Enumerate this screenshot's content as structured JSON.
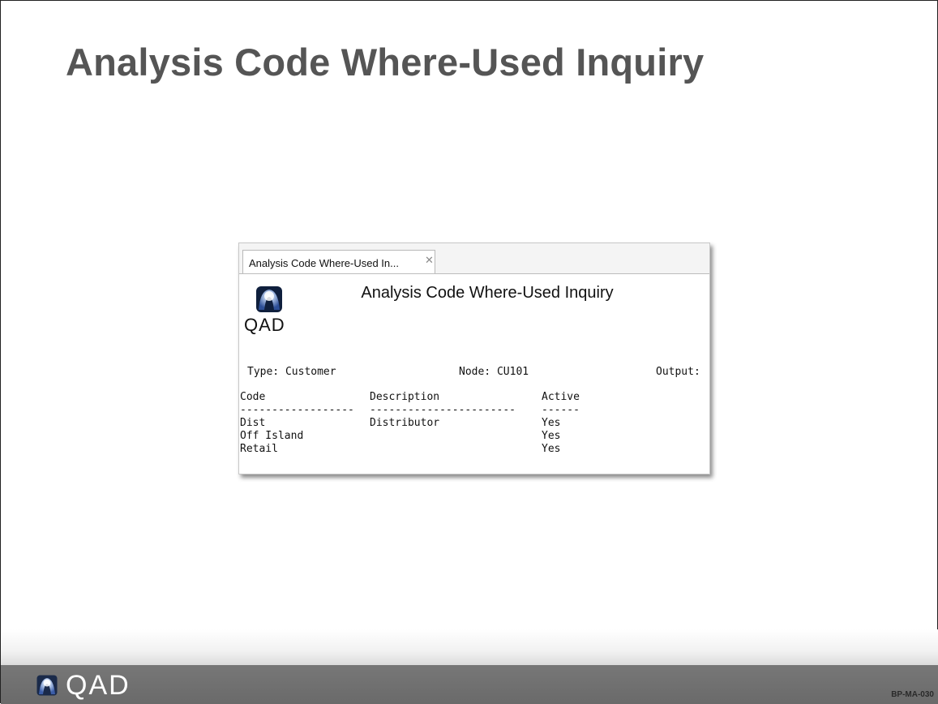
{
  "slide": {
    "title": "Analysis Code Where-Used Inquiry",
    "code": "BP-MA-030",
    "footer_logo_text": "QAD"
  },
  "window": {
    "tab_label": "Analysis Code Where-Used In...",
    "tab_close_glyph": "✕",
    "logo_text": "QAD",
    "report_title": "Analysis Code Where-Used Inquiry",
    "params": {
      "type": "Type: Customer",
      "node": "Node: CU101",
      "output": "Output:"
    },
    "table": {
      "columns": [
        "Code",
        "Description",
        "Active"
      ],
      "separators": [
        "------------------",
        "-----------------------",
        "------"
      ],
      "rows": [
        {
          "code": "Dist",
          "description": "Distributor",
          "active": "Yes"
        },
        {
          "code": "Off Island",
          "description": "",
          "active": "Yes"
        },
        {
          "code": "Retail",
          "description": "",
          "active": "Yes"
        }
      ]
    }
  },
  "colors": {
    "title_gray": "#555555",
    "footer_bar": "#6e6e6e",
    "logo_blue": "#3b5da8"
  },
  "icons": [
    "qad-logo-icon",
    "close-icon"
  ]
}
